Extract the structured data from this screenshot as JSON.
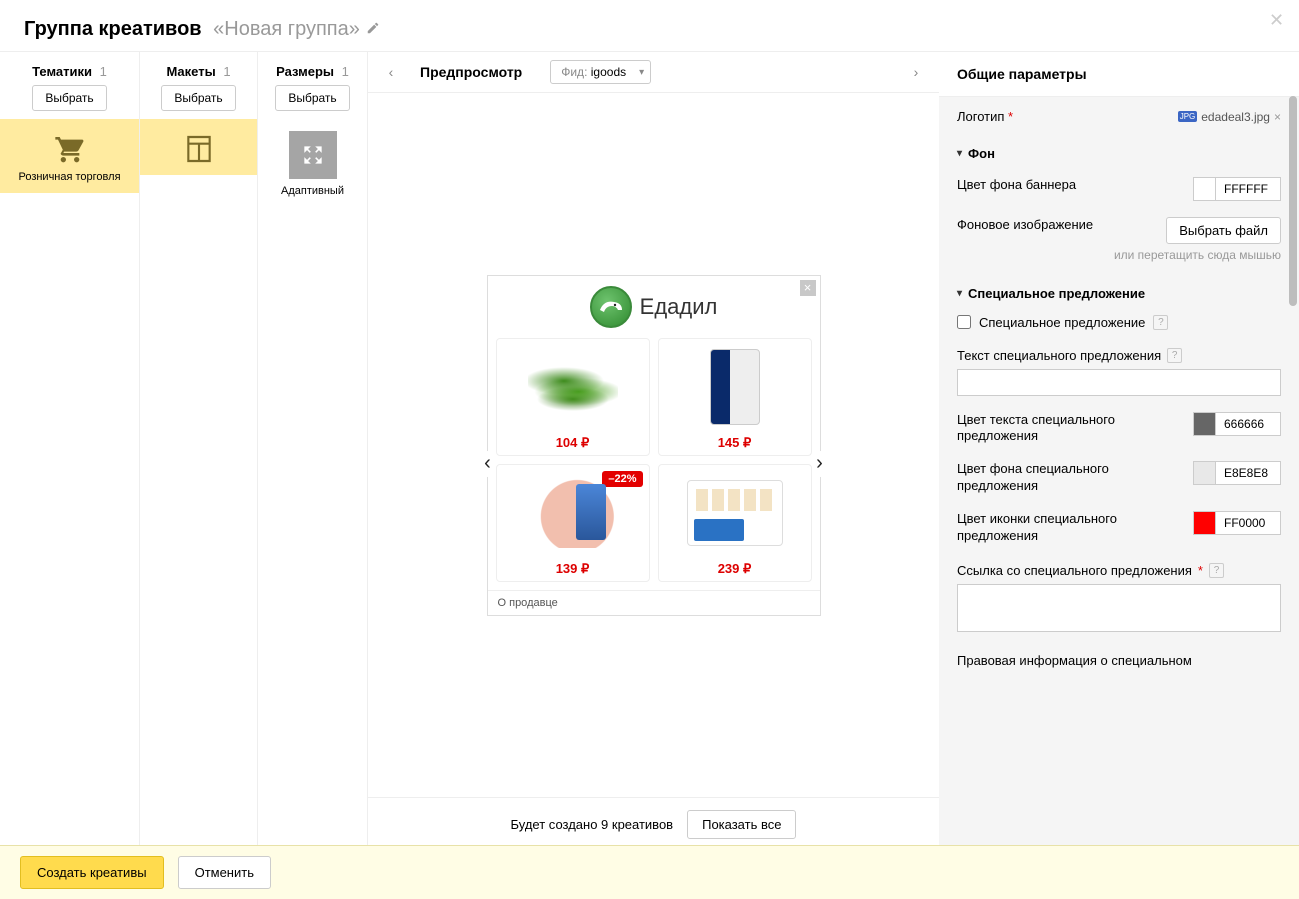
{
  "header": {
    "title": "Группа креативов",
    "group_name": "«Новая группа»"
  },
  "columns": {
    "themes": {
      "title": "Тематики",
      "count": "1",
      "select": "Выбрать",
      "item": "Розничная торговля"
    },
    "layouts": {
      "title": "Макеты",
      "count": "1",
      "select": "Выбрать"
    },
    "sizes": {
      "title": "Размеры",
      "count": "1",
      "select": "Выбрать",
      "item": "Адаптивный"
    }
  },
  "preview": {
    "title": "Предпросмотр",
    "feed_label": "Фид:",
    "feed_value": "igoods",
    "brand": "Едадил",
    "products": [
      {
        "price": "104 ₽",
        "badge": ""
      },
      {
        "price": "145 ₽",
        "badge": ""
      },
      {
        "price": "139 ₽",
        "badge": "–22%"
      },
      {
        "price": "239 ₽",
        "badge": ""
      }
    ],
    "about": "О продавце",
    "footer_text": "Будет создано 9 креативов",
    "show_all": "Показать все"
  },
  "sidebar": {
    "title": "Общие параметры",
    "logo": {
      "label": "Логотип",
      "filename": "edadeal3.jpg"
    },
    "bg_section": "Фон",
    "bg_color": {
      "label": "Цвет фона баннера",
      "value": "FFFFFF",
      "hex": "#FFFFFF"
    },
    "bg_image": {
      "label": "Фоновое изображение",
      "button": "Выбрать файл",
      "hint": "или перетащить сюда мышью"
    },
    "special_section": "Специальное предложение",
    "special_checkbox": "Специальное предложение",
    "special_text_label": "Текст специального предложения",
    "special_text_color": {
      "label": "Цвет текста специального предложения",
      "value": "666666",
      "hex": "#666666"
    },
    "special_bg_color": {
      "label": "Цвет фона специального предложения",
      "value": "E8E8E8",
      "hex": "#E8E8E8"
    },
    "special_icon_color": {
      "label": "Цвет иконки специального предложения",
      "value": "FF0000",
      "hex": "#FF0000"
    },
    "special_link_label": "Ссылка со специального предложения",
    "legal_label": "Правовая информация о специальном"
  },
  "footer": {
    "create": "Создать креативы",
    "cancel": "Отменить"
  }
}
